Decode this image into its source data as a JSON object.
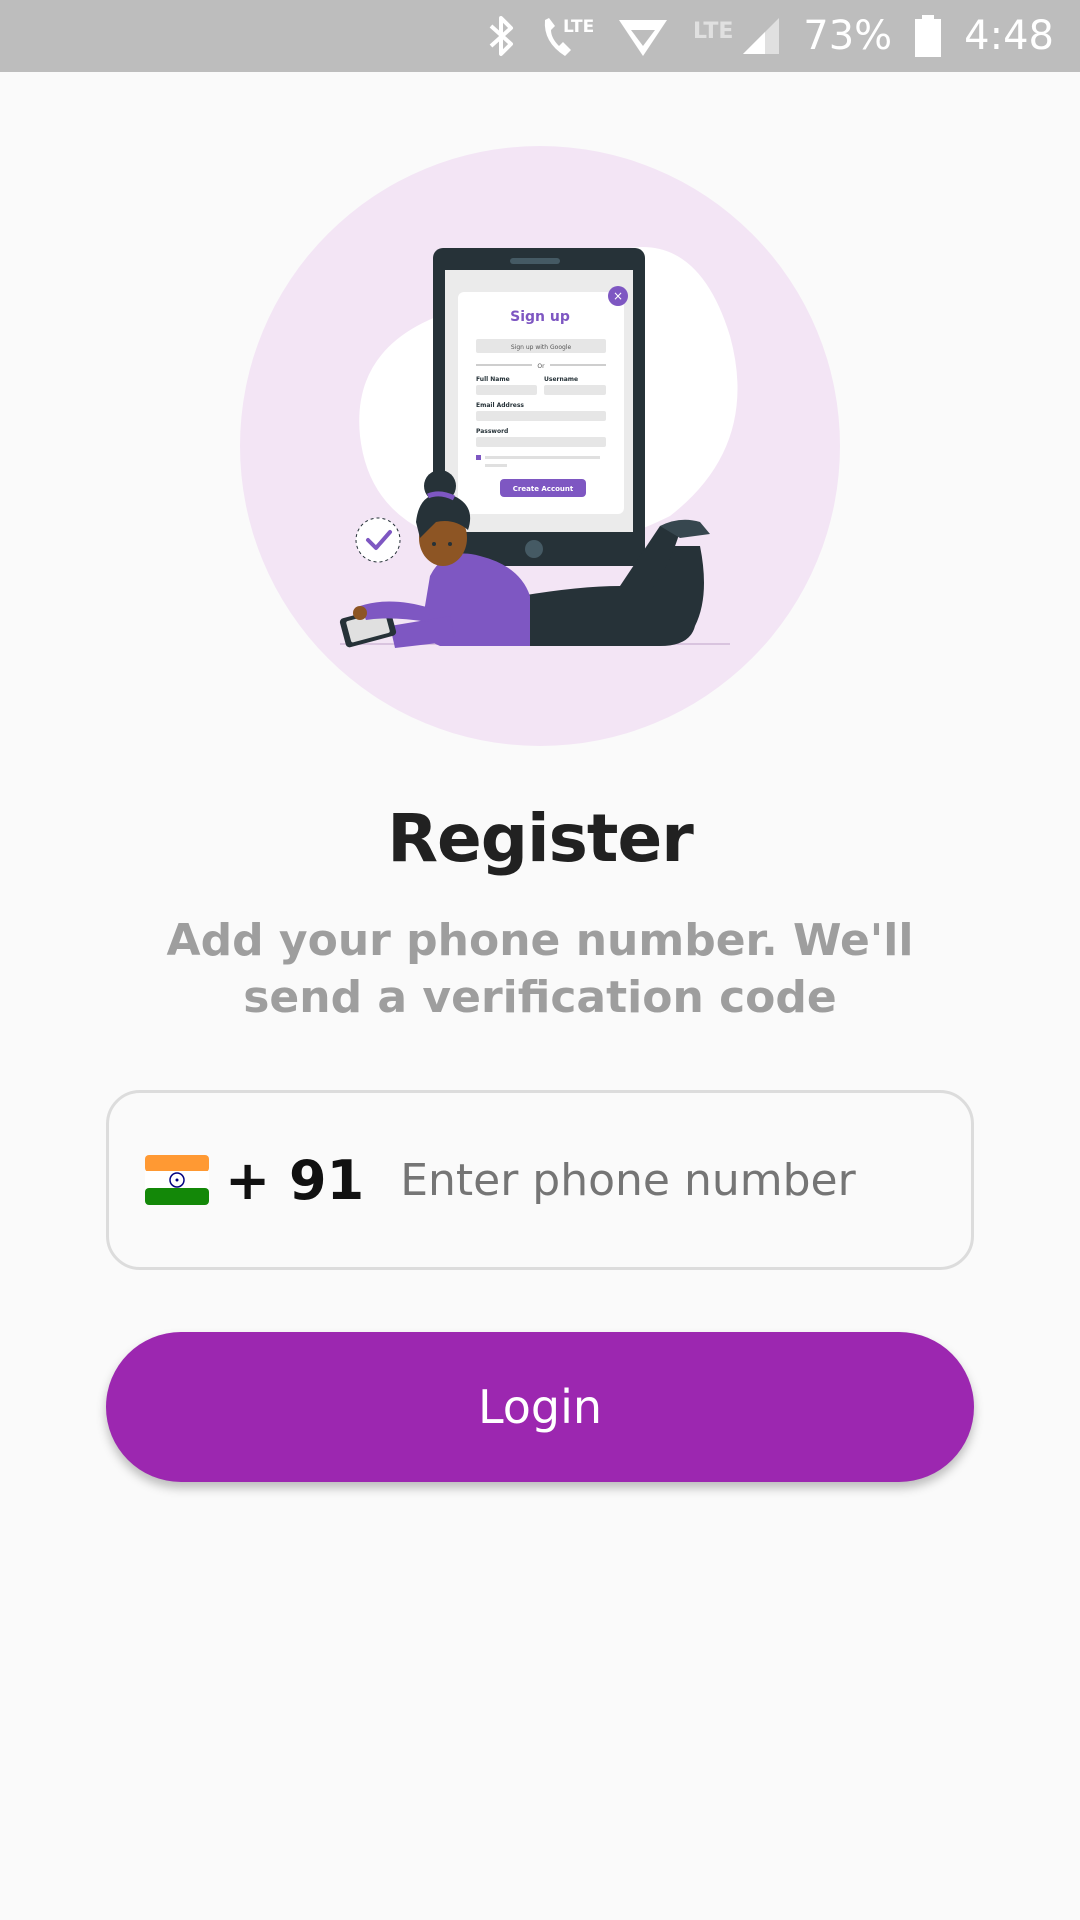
{
  "status_bar": {
    "icons": [
      "bluetooth-icon",
      "volte-call-icon",
      "wifi-icon",
      "lte-icon",
      "signal-icon"
    ],
    "battery_percent": "73%",
    "time": "4:48"
  },
  "illustration": {
    "screen_title": "Sign up",
    "google_button": "Sign up with Google",
    "separator": "Or",
    "full_name_label": "Full Name",
    "username_label": "Username",
    "email_label": "Email Address",
    "password_label": "Password",
    "create_button": "Create Account"
  },
  "page": {
    "title": "Register",
    "subtitle": "Add your phone number. We'll send a verification code"
  },
  "phone": {
    "country_flag": "india-flag-icon",
    "dial_code": "+ 91",
    "placeholder": "Enter phone number",
    "value": ""
  },
  "login": {
    "label": "Login"
  },
  "colors": {
    "accent": "#9c27b0",
    "illustration_purple": "#7e57c2",
    "circle": "#f3e5f5",
    "status_bar": "#bdbdbd"
  }
}
